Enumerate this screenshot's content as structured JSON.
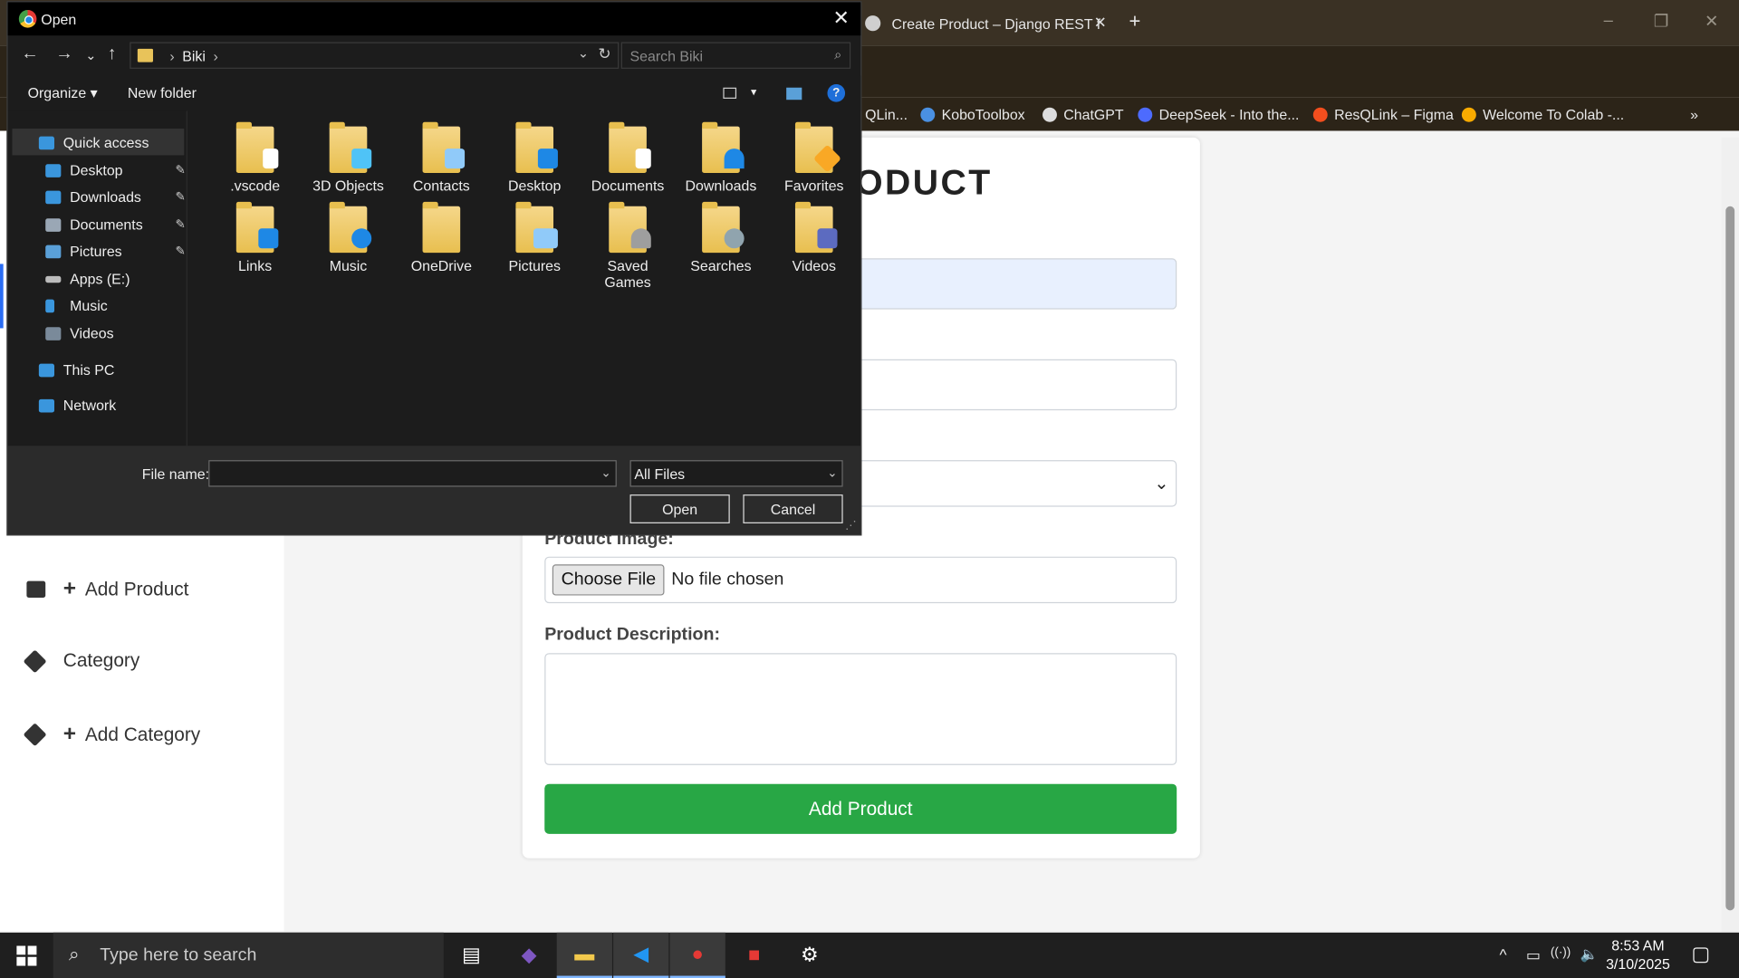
{
  "browser": {
    "tab_title": "Create Product – Django REST f",
    "tab_close": "✕",
    "new_tab": "+",
    "window_controls": [
      "–",
      "❐",
      "✕"
    ],
    "toolbar_icons": [
      "install-icon",
      "star-icon",
      "extensions-icon",
      "profile-icon",
      "menu-icon"
    ],
    "bookmarks": [
      {
        "label": "QLin...",
        "color": "#888888"
      },
      {
        "label": "KoboToolbox",
        "color": "#4a90e2"
      },
      {
        "label": "ChatGPT",
        "color": "#dddddd"
      },
      {
        "label": "DeepSeek - Into the...",
        "color": "#4d6bfe"
      },
      {
        "label": "ResQLink – Figma",
        "color": "#f24e1e"
      },
      {
        "label": "Welcome To Colab -...",
        "color": "#f9ab00"
      }
    ],
    "bookmarks_more": "»"
  },
  "page": {
    "card_title": "ODUCT",
    "image_label": "Product Image:",
    "choose_file": "Choose File",
    "no_file": "No file chosen",
    "description_label": "Product Description:",
    "submit_label": "Add Product",
    "select_arrow": "⌄"
  },
  "sidebar": {
    "items": [
      {
        "label": "Add Product",
        "plus": "+"
      },
      {
        "label": "Category",
        "plus": ""
      },
      {
        "label": "Add Category",
        "plus": "+"
      }
    ]
  },
  "dialog": {
    "title": "Open",
    "close": "✕",
    "nav": {
      "back": "←",
      "forward": "→",
      "recent": "⌄",
      "up": "↑"
    },
    "address": {
      "segment": "Biki",
      "sep": "›",
      "drop": "⌄",
      "refresh": "↻"
    },
    "search_placeholder": "Search Biki",
    "organize": "Organize ▾",
    "new_folder": "New folder",
    "view_drop": "▾",
    "help": "?",
    "nav_pane": [
      {
        "label": "Quick access",
        "color": "#3a96dd",
        "pinned": false
      },
      {
        "label": "Desktop",
        "color": "#3a96dd",
        "pinned": true
      },
      {
        "label": "Downloads",
        "color": "#3a96dd",
        "pinned": true
      },
      {
        "label": "Documents",
        "color": "#9aa7b5",
        "pinned": true
      },
      {
        "label": "Pictures",
        "color": "#5aa0d8",
        "pinned": true
      },
      {
        "label": "Apps (E:)",
        "color": "#bbbbbb",
        "pinned": false
      },
      {
        "label": "Music",
        "color": "#3a96dd",
        "pinned": false
      },
      {
        "label": "Videos",
        "color": "#7a8a9a",
        "pinned": false
      },
      {
        "label": "This PC",
        "color": "#3a96dd",
        "pinned": false
      },
      {
        "label": "Network",
        "color": "#3a96dd",
        "pinned": false
      }
    ],
    "pin_glyph": "📌",
    "files": [
      {
        "label": ".vscode",
        "overlay": "#ffffff"
      },
      {
        "label": "3D Objects",
        "overlay": "#4fc3f7"
      },
      {
        "label": "Contacts",
        "overlay": "#90caf9"
      },
      {
        "label": "Desktop",
        "overlay": "#1e88e5"
      },
      {
        "label": "Documents",
        "overlay": "#ffffff"
      },
      {
        "label": "Downloads",
        "overlay": "#1e88e5"
      },
      {
        "label": "Favorites",
        "overlay": "#f9a825"
      },
      {
        "label": "Links",
        "overlay": "#1e88e5"
      },
      {
        "label": "Music",
        "overlay": "#1e88e5"
      },
      {
        "label": "OneDrive",
        "overlay": "#e8bf4f"
      },
      {
        "label": "Pictures",
        "overlay": "#90caf9"
      },
      {
        "label": "Saved Games",
        "overlay": "#9e9e9e"
      },
      {
        "label": "Searches",
        "overlay": "#90a4ae"
      },
      {
        "label": "Videos",
        "overlay": "#5c6bc0"
      }
    ],
    "file_name_label": "File name:",
    "file_name_value": "",
    "file_type": "All Files",
    "dropdown": "⌄",
    "open_label": "Open",
    "cancel_label": "Cancel",
    "grip": "⋰"
  },
  "taskbar": {
    "search_placeholder": "Type here to search",
    "search_icon": "⌕",
    "apps": [
      {
        "name": "task-view",
        "glyph": "▤",
        "color": "#ffffff"
      },
      {
        "name": "copilot",
        "glyph": "◆",
        "color": "#7e57c2"
      },
      {
        "name": "file-explorer",
        "glyph": "▬",
        "color": "#f2c94c"
      },
      {
        "name": "vscode",
        "glyph": "◀",
        "color": "#2196f3"
      },
      {
        "name": "chrome",
        "glyph": "●",
        "color": "#e53935"
      },
      {
        "name": "app-red",
        "glyph": "■",
        "color": "#e53935"
      },
      {
        "name": "settings",
        "glyph": "⚙",
        "color": "#ffffff"
      }
    ],
    "tray_icons": [
      "^",
      "▭",
      "((·))",
      "🔇"
    ],
    "time": "8:53 AM",
    "date": "3/10/2025",
    "notifications": "▢"
  }
}
